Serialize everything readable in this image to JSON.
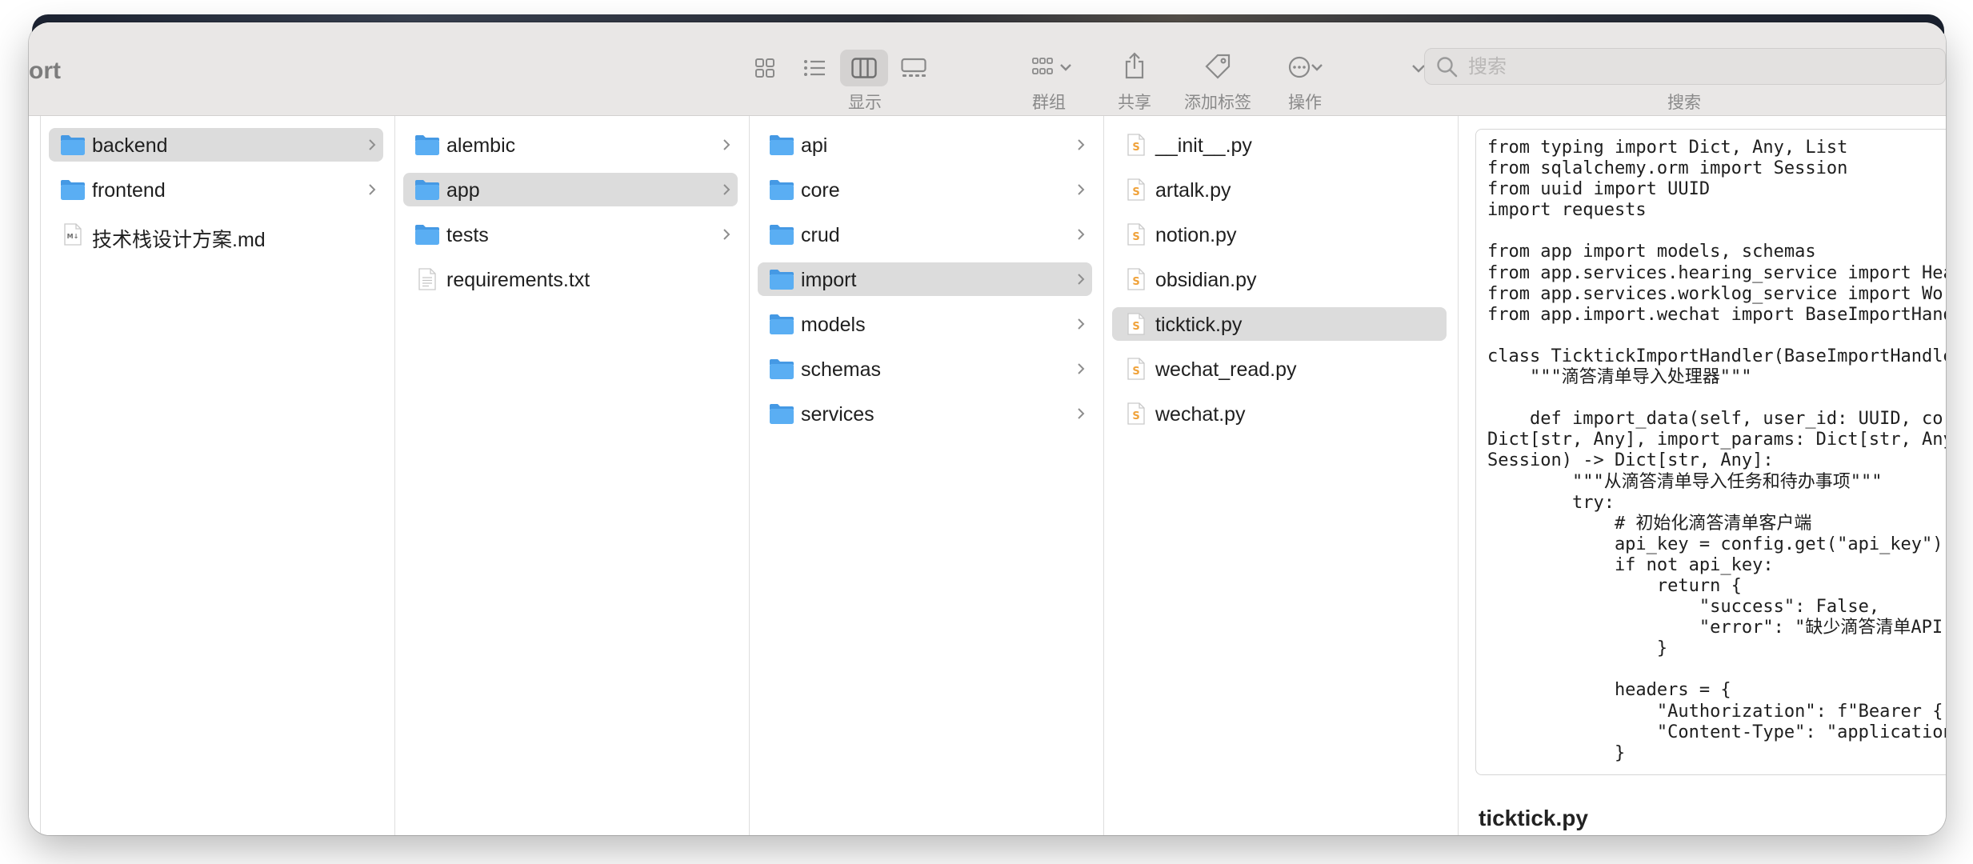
{
  "window": {
    "title_fragment": "ort"
  },
  "toolbar": {
    "view_label": "显示",
    "group_label": "群组",
    "share_label": "共享",
    "tag_label": "添加标签",
    "action_label": "操作",
    "search_label": "搜索",
    "search_placeholder": "搜索"
  },
  "columns": [
    {
      "items": [
        {
          "name": "backend",
          "type": "folder",
          "selected": true,
          "chevron": true
        },
        {
          "name": "frontend",
          "type": "folder",
          "selected": false,
          "chevron": true
        },
        {
          "name": "技术栈设计方案.md",
          "type": "markdown",
          "selected": false,
          "chevron": false
        }
      ]
    },
    {
      "items": [
        {
          "name": "alembic",
          "type": "folder",
          "selected": false,
          "chevron": true
        },
        {
          "name": "app",
          "type": "folder",
          "selected": true,
          "chevron": true
        },
        {
          "name": "tests",
          "type": "folder",
          "selected": false,
          "chevron": true
        },
        {
          "name": "requirements.txt",
          "type": "text",
          "selected": false,
          "chevron": false
        }
      ]
    },
    {
      "items": [
        {
          "name": "api",
          "type": "folder",
          "selected": false,
          "chevron": true
        },
        {
          "name": "core",
          "type": "folder",
          "selected": false,
          "chevron": true
        },
        {
          "name": "crud",
          "type": "folder",
          "selected": false,
          "chevron": true
        },
        {
          "name": "import",
          "type": "folder",
          "selected": true,
          "chevron": true
        },
        {
          "name": "models",
          "type": "folder",
          "selected": false,
          "chevron": true
        },
        {
          "name": "schemas",
          "type": "folder",
          "selected": false,
          "chevron": true
        },
        {
          "name": "services",
          "type": "folder",
          "selected": false,
          "chevron": true
        }
      ]
    },
    {
      "items": [
        {
          "name": "__init__.py",
          "type": "python",
          "selected": false,
          "chevron": false
        },
        {
          "name": "artalk.py",
          "type": "python",
          "selected": false,
          "chevron": false
        },
        {
          "name": "notion.py",
          "type": "python",
          "selected": false,
          "chevron": false
        },
        {
          "name": "obsidian.py",
          "type": "python",
          "selected": false,
          "chevron": false
        },
        {
          "name": "ticktick.py",
          "type": "python",
          "selected": true,
          "chevron": false
        },
        {
          "name": "wechat_read.py",
          "type": "python",
          "selected": false,
          "chevron": false
        },
        {
          "name": "wechat.py",
          "type": "python",
          "selected": false,
          "chevron": false
        }
      ]
    }
  ],
  "preview": {
    "code_lines": [
      "from typing import Dict, Any, List",
      "from sqlalchemy.orm import Session",
      "from uuid import UUID",
      "import requests",
      "",
      "from app import models, schemas",
      "from app.services.hearing_service import Hea",
      "from app.services.worklog_service import Wo",
      "from app.import.wechat import BaseImportHand",
      "",
      "class TicktickImportHandler(BaseImportHandle",
      "    \"\"\"滴答清单导入处理器\"\"\"",
      "",
      "    def import_data(self, user_id: UUID, co",
      "Dict[str, Any], import_params: Dict[str, Any",
      "Session) -> Dict[str, Any]:",
      "        \"\"\"从滴答清单导入任务和待办事项\"\"\"",
      "        try:",
      "            # 初始化滴答清单客户端",
      "            api_key = config.get(\"api_key\")",
      "            if not api_key:",
      "                return {",
      "                    \"success\": False,",
      "                    \"error\": \"缺少滴答清单API",
      "                }",
      "",
      "            headers = {",
      "                \"Authorization\": f\"Bearer {",
      "                \"Content-Type\": \"application",
      "            }"
    ],
    "file_title": "ticktick.py"
  },
  "colors": {
    "folder": "#5aaef3",
    "folder_tab": "#4599e4",
    "selected_row": "#dcdcdc",
    "toolbar_bg": "#e9e7e6",
    "python_badge": "#f0a23a"
  }
}
